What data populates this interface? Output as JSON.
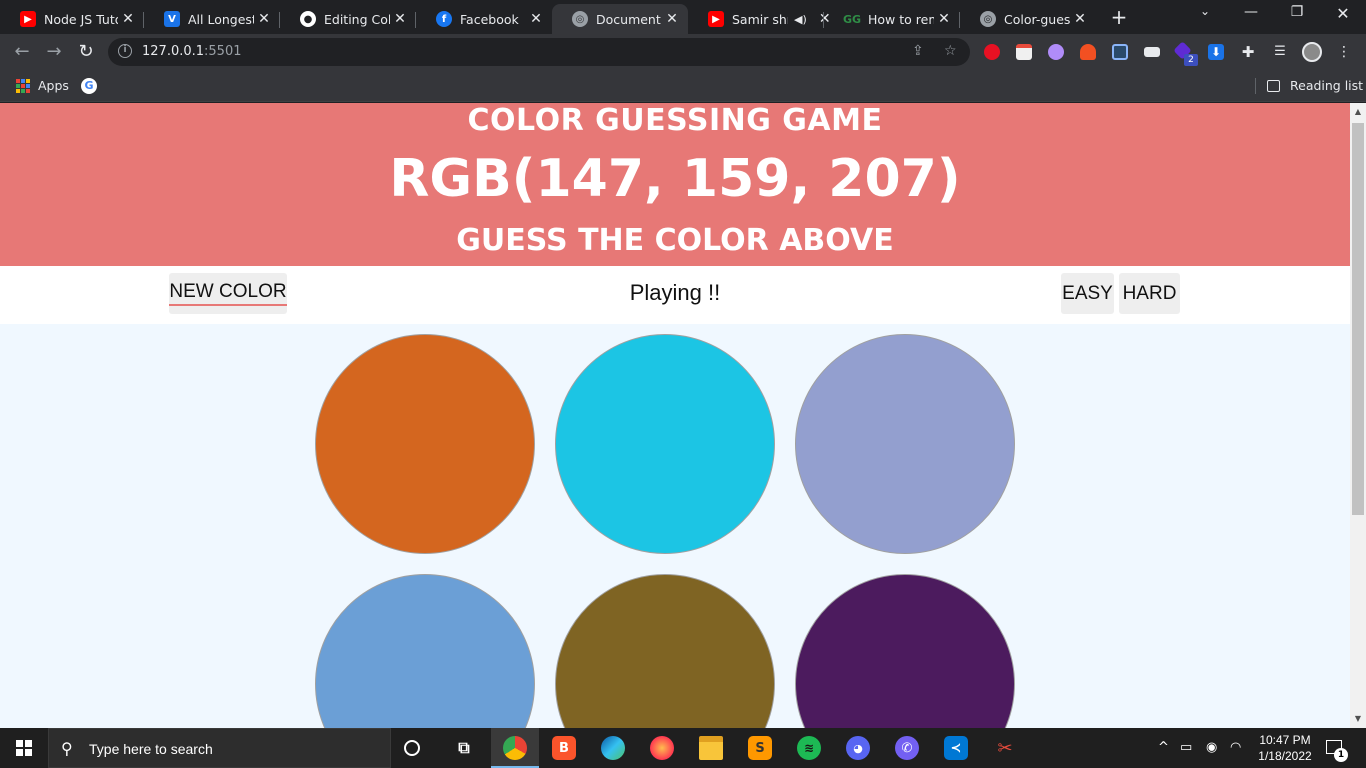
{
  "browser": {
    "tabs": [
      {
        "title": "Node JS Tutorial",
        "favicon": "youtube-icon",
        "color": "#ff0000"
      },
      {
        "title": "All Longest Str",
        "favicon": "v-icon",
        "color": "#1a73e8"
      },
      {
        "title": "Editing Color-",
        "favicon": "github-icon",
        "color": "#ffffff"
      },
      {
        "title": "Facebook",
        "favicon": "facebook-icon",
        "color": "#1877f2"
      },
      {
        "title": "Document",
        "favicon": "globe-icon",
        "color": "#9aa0a6"
      },
      {
        "title": "Samir shr",
        "favicon": "youtube-icon",
        "color": "#ff0000"
      },
      {
        "title": "How to remo",
        "favicon": "gfg-icon",
        "color": "#2f8d46"
      },
      {
        "title": "Color-guessin",
        "favicon": "globe-icon",
        "color": "#9aa0a6"
      }
    ],
    "url_host": "127.0.0.1",
    "url_port": ":5501",
    "extension_badge": "2",
    "bookmarks": {
      "apps": "Apps",
      "reading_list": "Reading list"
    }
  },
  "game": {
    "title": "COLOR GUESSING GAME",
    "rgb": "RGB(147, 159, 207)",
    "subtitle": "GUESS THE COLOR ABOVE",
    "header_color": "#e77876",
    "new_color_label": "NEW COLOR",
    "status": "Playing !!",
    "easy_label": "EASY",
    "hard_label": "HARD",
    "squares": [
      "#d4661f",
      "#1cc5e4",
      "#939fcf",
      "#6b9fd6",
      "#7f6423",
      "#4c1b5e"
    ]
  },
  "taskbar": {
    "search_placeholder": "Type here to search",
    "time": "10:47 PM",
    "date": "1/18/2022",
    "notification_count": "1"
  }
}
